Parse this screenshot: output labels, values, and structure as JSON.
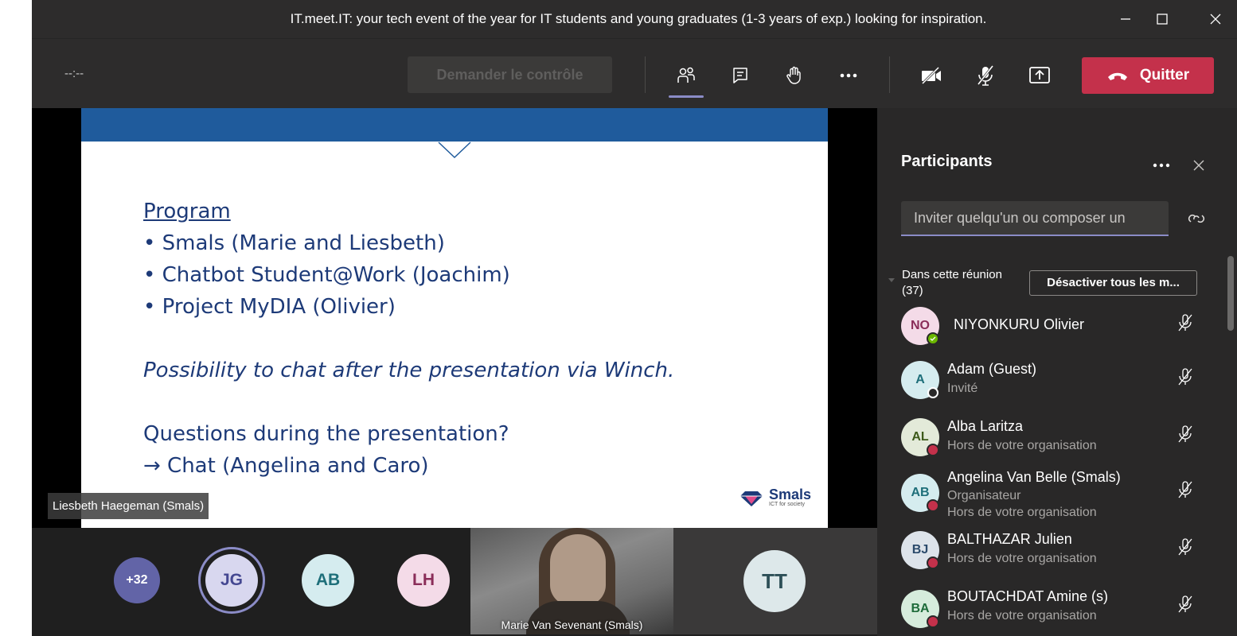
{
  "window": {
    "title": "IT.meet.IT: your tech event of the year for IT students and young graduates (1-3 years of exp.) looking for inspiration."
  },
  "toolbar": {
    "timer": "--:--",
    "request_control_label": "Demander le contrôle",
    "quit_label": "Quitter",
    "icons": [
      "people-icon",
      "chat-icon",
      "raise-hand-icon",
      "more-icon",
      "camera-off-icon",
      "mic-off-icon",
      "share-tray-icon",
      "phone-hangup-icon"
    ]
  },
  "slide": {
    "heading": "Program",
    "bullets": [
      "Smals (Marie and Liesbeth)",
      "Chatbot Student@Work (Joachim)",
      "Project MyDIA (Olivier)"
    ],
    "chat_note": "Possibility to chat after the presentation via Winch.",
    "questions_line": "Questions during the presentation?",
    "chat_line": "→ Chat (Angelina and Caro)",
    "logo_text": "Smals",
    "logo_tagline": "ICT for society"
  },
  "stage": {
    "speaker_name": "Liesbeth Haegeman (Smals)"
  },
  "gallery": {
    "overflow_count": "+32",
    "avatars": [
      {
        "initials": "JG",
        "bg": "#d8d7ef",
        "fg": "#444791"
      },
      {
        "initials": "AB",
        "bg": "#d5ecef",
        "fg": "#1e6f7a"
      },
      {
        "initials": "LH",
        "bg": "#f4dbe8",
        "fg": "#8a2d59"
      }
    ],
    "video_name": "Marie Van Sevenant (Smals)",
    "tt_initials": "TT"
  },
  "panel": {
    "title": "Participants",
    "invite_placeholder": "Inviter quelqu'un ou composer un",
    "section_label": "Dans cette réunion",
    "section_count": "(37)",
    "mute_all_label": "Désactiver tous les m...",
    "participants": [
      {
        "initials": "NO",
        "name": "NIYONKURU Olivier",
        "sub1": "",
        "sub2": "",
        "av_bg": "#f4dbe8",
        "av_fg": "#8a2d59",
        "status": "available",
        "status_color": "#6bb700"
      },
      {
        "initials": "A",
        "name": "Adam (Guest)",
        "sub1": "Invité",
        "sub2": "",
        "av_bg": "#d5ecef",
        "av_fg": "#1e6f7a",
        "status": "offline",
        "status_color": "#ffffff"
      },
      {
        "initials": "AL",
        "name": "Alba Laritza",
        "sub1": "Hors de votre organisation",
        "sub2": "",
        "av_bg": "#e3ead9",
        "av_fg": "#3d5a1a",
        "status": "busy",
        "status_color": "#c4314b"
      },
      {
        "initials": "AB",
        "name": "Angelina Van Belle (Smals)",
        "sub1": "Organisateur",
        "sub2": "Hors de votre organisation",
        "av_bg": "#d5ecef",
        "av_fg": "#1e6f7a",
        "status": "busy",
        "status_color": "#c4314b"
      },
      {
        "initials": "BJ",
        "name": "BALTHAZAR Julien",
        "sub1": "Hors de votre organisation",
        "sub2": "",
        "av_bg": "#dde3ea",
        "av_fg": "#2b4a6b",
        "status": "busy",
        "status_color": "#c4314b"
      },
      {
        "initials": "BA",
        "name": "BOUTACHDAT Amine (s)",
        "sub1": "Hors de votre organisation",
        "sub2": "",
        "av_bg": "#d6ecdc",
        "av_fg": "#1e6b3a",
        "status": "busy",
        "status_color": "#c4314b"
      }
    ]
  },
  "colors": {
    "accent": "#8b8cc7",
    "quit": "#c4314b",
    "slide_band": "#1f5b9c",
    "slide_text": "#1d3a78"
  }
}
